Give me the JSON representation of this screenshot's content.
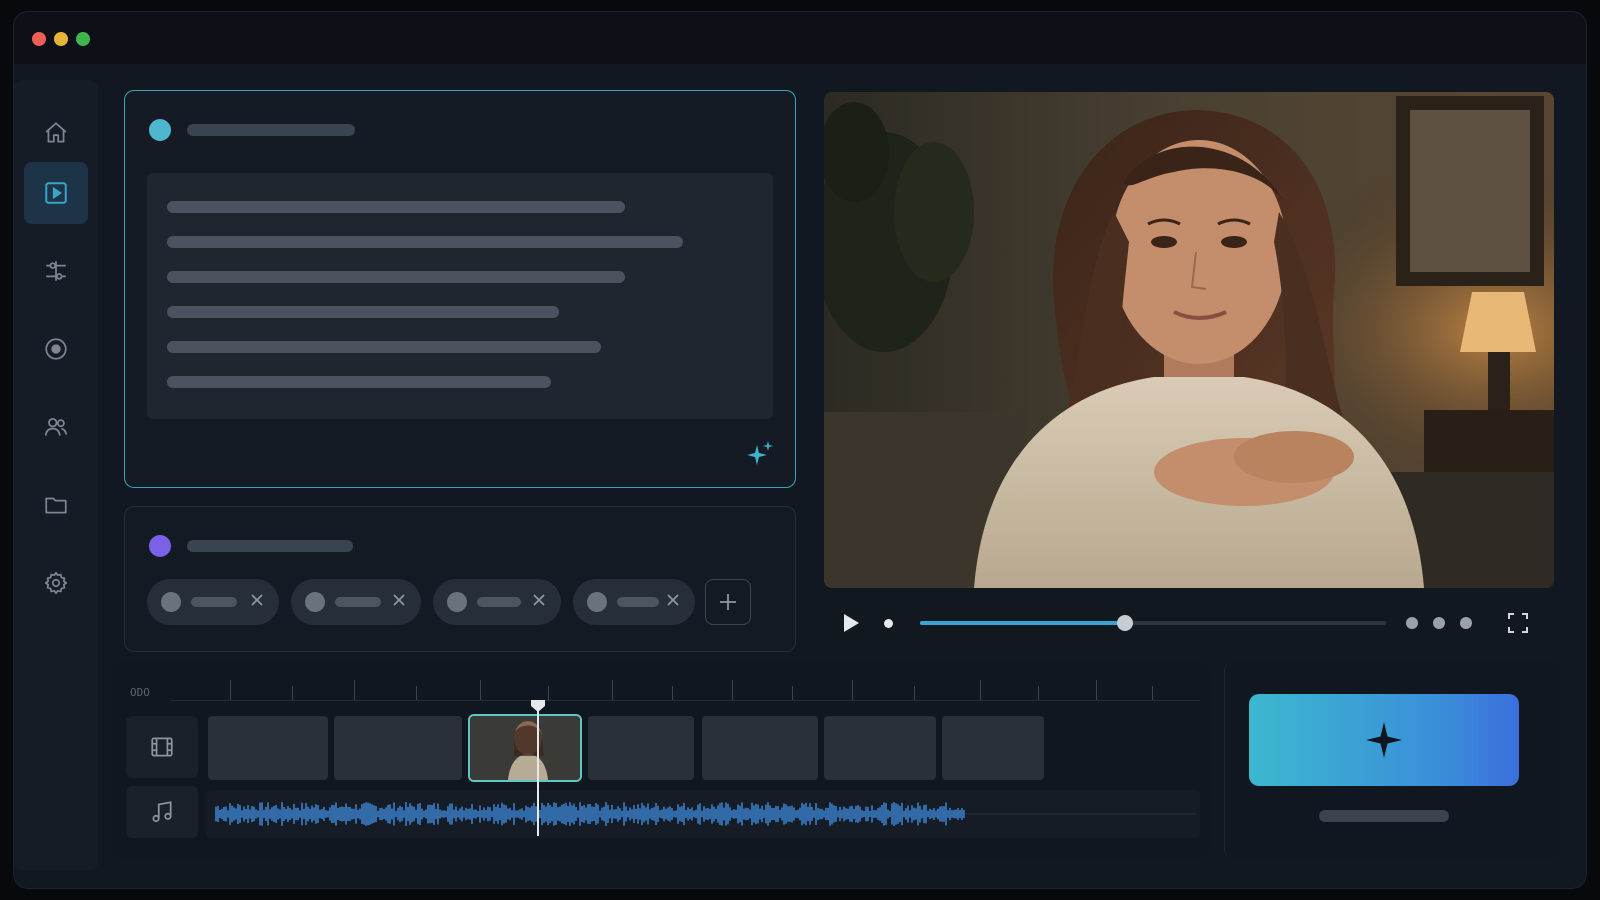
{
  "window": {
    "traffic_lights": {
      "close": "#ec5f57",
      "minimize": "#e8b33a",
      "maximize": "#3fb64d"
    }
  },
  "sidebar": {
    "items": [
      {
        "id": "home",
        "icon": "home-icon",
        "active": false
      },
      {
        "id": "video",
        "icon": "play-square-icon",
        "active": true
      },
      {
        "id": "adjust",
        "icon": "sliders-icon",
        "active": false
      },
      {
        "id": "record",
        "icon": "record-icon",
        "active": false
      },
      {
        "id": "people",
        "icon": "users-icon",
        "active": false
      },
      {
        "id": "files",
        "icon": "folder-icon",
        "active": false
      },
      {
        "id": "settings",
        "icon": "gear-icon",
        "active": false
      }
    ],
    "active_color": "#3aa5c8",
    "icon_color": "#7d8793"
  },
  "script_panel": {
    "accent": "#3aa5b8",
    "dot_color": "#4fb6cf",
    "lines": 6,
    "icon": "sparkle-icon"
  },
  "voice_panel": {
    "dot_color": "#7b61e8",
    "chips": 4,
    "add_icon": "plus-icon"
  },
  "player": {
    "progress": 0.44,
    "icons": [
      "play-icon",
      "fullscreen-icon"
    ]
  },
  "timeline": {
    "ruler_label": "ODO",
    "clips": 7,
    "selected_clip": 2,
    "playhead_progress": 0.33,
    "audio_waveform_color": "#3a7fc8",
    "track_icons": [
      "film-icon",
      "music-note-icon"
    ]
  },
  "generate": {
    "icon": "sparkle-icon",
    "gradient_start": "#3cb8cf",
    "gradient_end": "#3b6fdc"
  }
}
